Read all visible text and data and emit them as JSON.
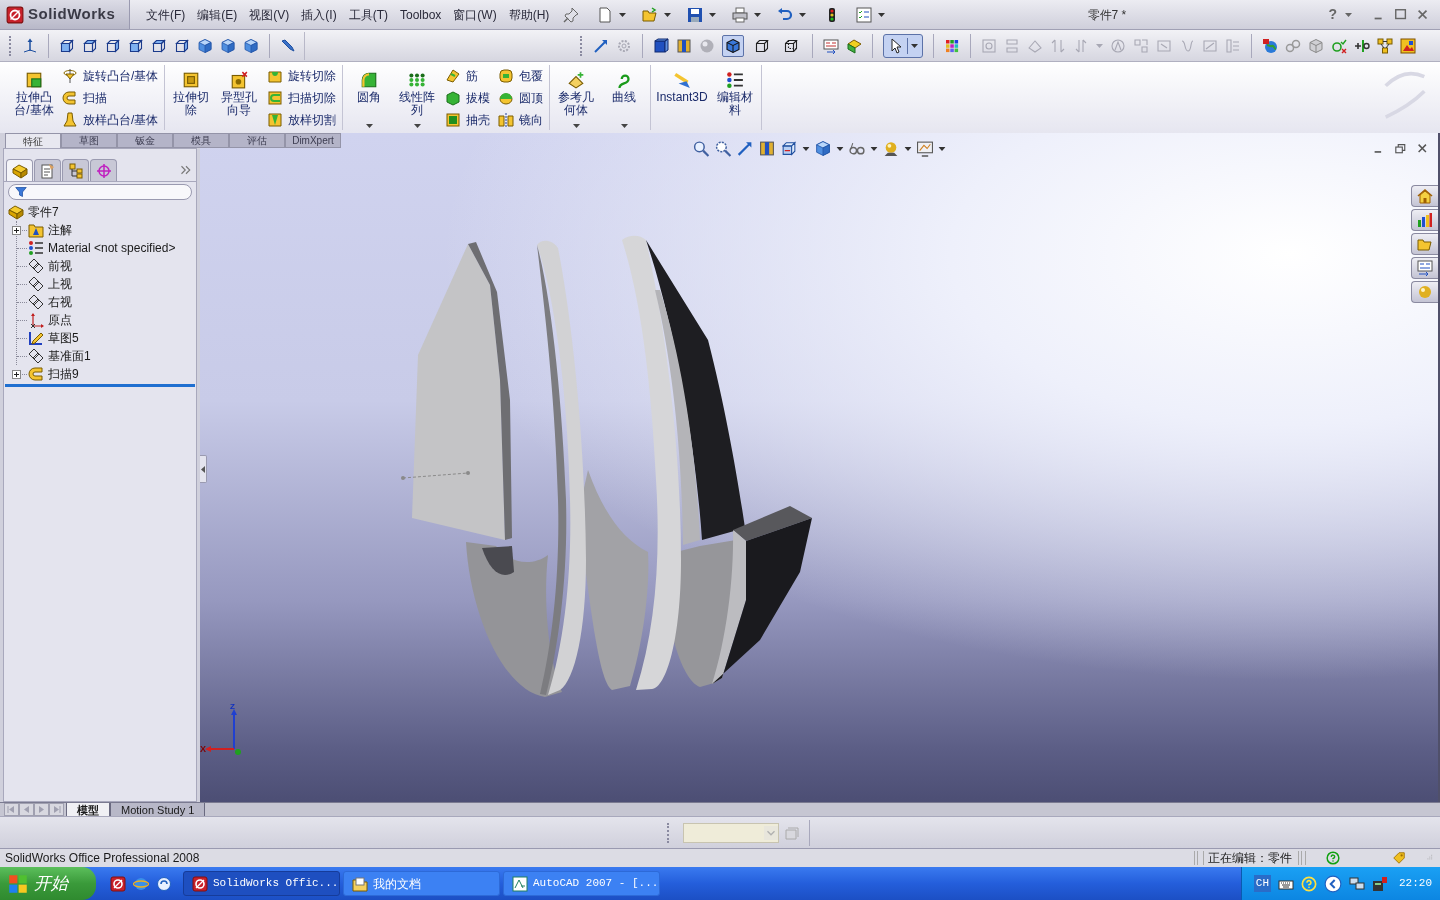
{
  "app": {
    "logo": "SolidWorks"
  },
  "menu_bar": {
    "items": [
      "文件(F)",
      "编辑(E)",
      "视图(V)",
      "插入(I)",
      "工具(T)",
      "Toolbox",
      "窗口(W)",
      "帮助(H)"
    ]
  },
  "window": {
    "title": "零件7 *",
    "help_glyph": "?"
  },
  "view_toolbar": {
    "display_styles": [
      {
        "selected": true
      },
      {
        "selected": false
      },
      {
        "selected": false
      }
    ],
    "select_tool": {
      "selected": true
    },
    "sketch_group": {
      "disabled": true
    }
  },
  "command_manager": {
    "groups": [
      {
        "items": [
          {
            "kind": "large",
            "label": "拉伸凸台/基体",
            "dropdown": false
          },
          {
            "kind": "column",
            "labels": [
              "旋转凸台/基体",
              "扫描",
              "放样凸台/基体"
            ]
          }
        ]
      },
      {
        "items": [
          {
            "kind": "large",
            "label": "拉伸切除",
            "dropdown": false
          },
          {
            "kind": "large",
            "label": "异型孔向导",
            "dropdown": false
          },
          {
            "kind": "column",
            "labels": [
              "旋转切除",
              "扫描切除",
              "放样切割"
            ]
          }
        ]
      },
      {
        "items": [
          {
            "kind": "large",
            "label": "圆角",
            "dropdown": true
          },
          {
            "kind": "large",
            "label": "线性阵列",
            "dropdown": true
          },
          {
            "kind": "column",
            "labels": [
              "筋",
              "拔模",
              "抽壳"
            ]
          },
          {
            "kind": "column",
            "labels": [
              "包覆",
              "圆顶",
              "镜向"
            ]
          }
        ]
      },
      {
        "items": [
          {
            "kind": "large",
            "label": "参考几何体",
            "dropdown": true
          },
          {
            "kind": "large",
            "label": "曲线",
            "dropdown": true
          }
        ]
      },
      {
        "items": [
          {
            "kind": "large",
            "label": "Instant3D",
            "dropdown": false
          },
          {
            "kind": "large",
            "label": "编辑材料",
            "dropdown": false
          }
        ]
      }
    ]
  },
  "command_tabs": [
    {
      "label": "特征",
      "selected": true
    },
    {
      "label": "草图",
      "selected": false
    },
    {
      "label": "钣金",
      "selected": false
    },
    {
      "label": "模具",
      "selected": false
    },
    {
      "label": "评估",
      "selected": false
    },
    {
      "label": "DimXpert",
      "selected": false
    }
  ],
  "feature_panel": {
    "tabs": [
      {
        "selected": true
      },
      {
        "selected": false
      },
      {
        "selected": false
      },
      {
        "selected": false
      }
    ],
    "tree": {
      "label": "零件7",
      "children": [
        {
          "kind": "annotations",
          "label": "注解",
          "expandable": true
        },
        {
          "kind": "material",
          "label": "Material <not specified>",
          "expandable": false
        },
        {
          "kind": "plane",
          "label": "前视",
          "expandable": false
        },
        {
          "kind": "plane",
          "label": "上视",
          "expandable": false
        },
        {
          "kind": "plane",
          "label": "右视",
          "expandable": false
        },
        {
          "kind": "origin",
          "label": "原点",
          "expandable": false
        },
        {
          "kind": "sketch",
          "label": "草图5",
          "expandable": false
        },
        {
          "kind": "plane",
          "label": "基准面1",
          "expandable": false
        },
        {
          "kind": "sweep",
          "label": "扫描9",
          "expandable": true
        }
      ]
    }
  },
  "viewport": {
    "triad": {
      "z_label": "Z",
      "x_label": "X"
    }
  },
  "bottom_tabs": [
    {
      "label": "模型",
      "selected": true
    },
    {
      "label": "Motion Study 1",
      "selected": false
    }
  ],
  "status_bar": {
    "product": "SolidWorks Office Professional 2008",
    "mode": "正在编辑：零件"
  },
  "taskbar": {
    "start": "开始",
    "tasks": [
      {
        "label": "SolidWorks Offic...",
        "active": true
      },
      {
        "label": "我的文档",
        "active": false
      },
      {
        "label": "AutoCAD 2007 - [...",
        "active": false
      }
    ],
    "language": "CH",
    "clock": "22:20"
  }
}
